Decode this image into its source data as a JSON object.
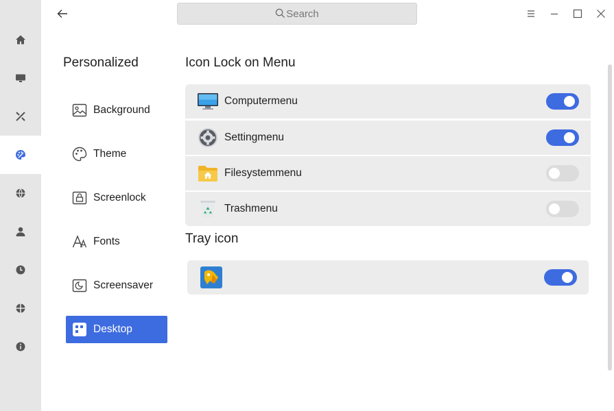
{
  "rail": {
    "items": [
      {
        "icon": "home-icon"
      },
      {
        "icon": "display-icon"
      },
      {
        "icon": "tools-icon"
      },
      {
        "icon": "palette-icon",
        "active": true
      },
      {
        "icon": "globe-icon"
      },
      {
        "icon": "user-icon"
      },
      {
        "icon": "clock-icon"
      },
      {
        "icon": "target-icon"
      },
      {
        "icon": "info-icon"
      }
    ]
  },
  "search": {
    "placeholder": "Search"
  },
  "sidebar": {
    "title": "Personalized",
    "items": [
      {
        "label": "Background",
        "icon": "image-icon"
      },
      {
        "label": "Theme",
        "icon": "theme-palette-icon"
      },
      {
        "label": "Screenlock",
        "icon": "screenlock-icon"
      },
      {
        "label": "Fonts",
        "icon": "fonts-icon"
      },
      {
        "label": "Screensaver",
        "icon": "screensaver-icon"
      },
      {
        "label": "Desktop",
        "icon": "desktop-grid-icon",
        "active": true
      }
    ]
  },
  "main": {
    "icon_lock_heading": "Icon Lock on Menu",
    "menu_items": [
      {
        "label": "Computermenu",
        "icon": "computer-icon",
        "enabled": true
      },
      {
        "label": "Settingmenu",
        "icon": "settings-gear-icon",
        "enabled": true
      },
      {
        "label": "Filesystemmenu",
        "icon": "home-folder-icon",
        "enabled": false
      },
      {
        "label": "Trashmenu",
        "icon": "trash-icon",
        "enabled": false
      }
    ],
    "tray_heading": "Tray icon",
    "tray_items": [
      {
        "icon": "tray-app-icon",
        "enabled": true
      }
    ]
  },
  "colors": {
    "accent": "#3d6be0",
    "rail_bg": "#e6e6e6",
    "row_bg": "#ececec",
    "toggle_off": "#dcdcdc"
  }
}
